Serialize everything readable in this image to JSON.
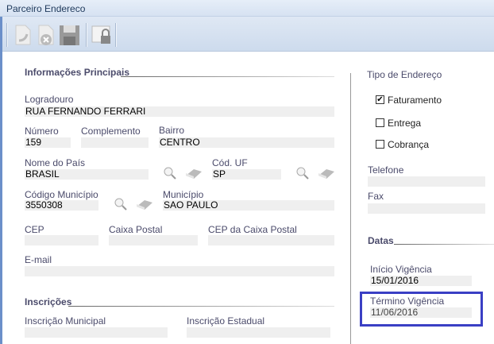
{
  "window": {
    "title": "Parceiro Endereco"
  },
  "toolbar": {
    "buttons": [
      "undo-icon",
      "cancel-icon",
      "save-icon",
      "lock-icon"
    ]
  },
  "main": {
    "section_title": "Informações Principais",
    "logradouro": {
      "label": "Logradouro",
      "value": "RUA FERNANDO FERRARI"
    },
    "numero": {
      "label": "Número",
      "value": "159"
    },
    "complemento": {
      "label": "Complemento",
      "value": ""
    },
    "bairro": {
      "label": "Bairro",
      "value": "CENTRO"
    },
    "pais": {
      "label": "Nome do País",
      "value": "BRASIL"
    },
    "uf": {
      "label": "Cód. UF",
      "value": "SP"
    },
    "cod_municipio": {
      "label": "Código Município",
      "value": "3550308"
    },
    "municipio": {
      "label": "Município",
      "value": "SAO PAULO"
    },
    "cep": {
      "label": "CEP",
      "value": ""
    },
    "caixa_postal": {
      "label": "Caixa Postal",
      "value": ""
    },
    "cep_caixa_postal": {
      "label": "CEP da Caixa Postal",
      "value": ""
    },
    "email": {
      "label": "E-mail",
      "value": ""
    },
    "inscricoes_title": "Inscrições",
    "insc_municipal": {
      "label": "Inscrição Municipal",
      "value": ""
    },
    "insc_estadual": {
      "label": "Inscrição Estadual",
      "value": ""
    }
  },
  "side": {
    "tipo_title": "Tipo de Endereço",
    "options": [
      {
        "label": "Faturamento",
        "checked": true
      },
      {
        "label": "Entrega",
        "checked": false
      },
      {
        "label": "Cobrança",
        "checked": false
      }
    ],
    "telefone": {
      "label": "Telefone",
      "value": ""
    },
    "fax": {
      "label": "Fax",
      "value": ""
    },
    "datas_title": "Datas",
    "inicio": {
      "label": "Início Vigência",
      "value": "15/01/2016"
    },
    "termino": {
      "label": "Término Vigência",
      "value": "11/06/2016"
    },
    "check_mark": "✔"
  },
  "colors": {
    "highlight": "#3a3fc4"
  }
}
